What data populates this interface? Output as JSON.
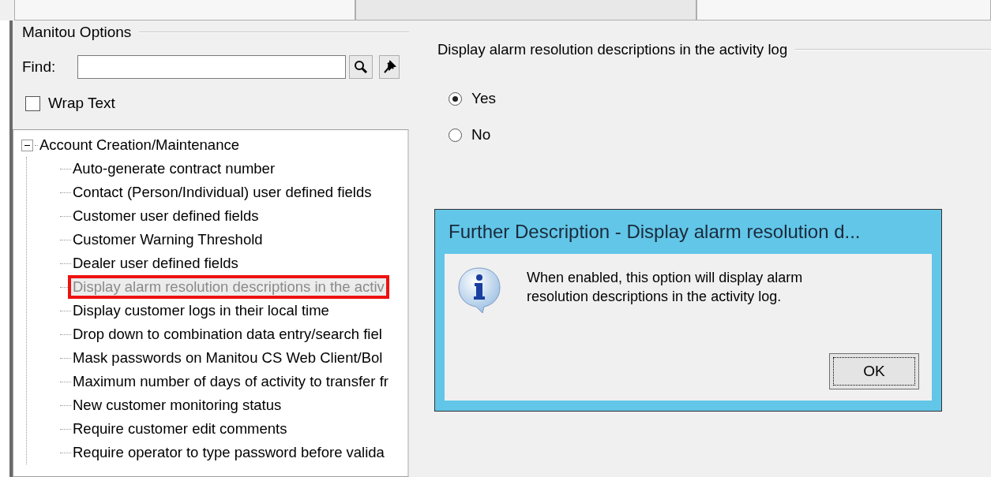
{
  "toolbar": {
    "buttons": [
      {
        "disabled": false
      },
      {
        "disabled": true
      },
      {
        "disabled": false
      }
    ]
  },
  "options_panel": {
    "title": "Manitou Options",
    "find": {
      "label": "Find:"
    },
    "wrap_text": {
      "label": "Wrap Text",
      "checked": false
    },
    "tree": [
      {
        "label": "Account Creation/Maintenance",
        "expanded": true,
        "selected": false,
        "children": [
          {
            "label": "Auto-generate contract number",
            "selected": false
          },
          {
            "label": "Contact (Person/Individual) user defined fields",
            "selected": false
          },
          {
            "label": "Customer user defined fields",
            "selected": false
          },
          {
            "label": "Customer Warning Threshold",
            "selected": false
          },
          {
            "label": "Dealer user defined fields",
            "selected": false
          },
          {
            "label": "Display alarm resolution descriptions in the activ",
            "selected": true
          },
          {
            "label": "Display customer logs in their local time",
            "selected": false
          },
          {
            "label": "Drop down to combination data entry/search fiel",
            "selected": false
          },
          {
            "label": "Mask passwords on Manitou CS Web Client/Bol",
            "selected": false
          },
          {
            "label": "Maximum number of days of activity to transfer fr",
            "selected": false
          },
          {
            "label": "New customer monitoring status",
            "selected": false
          },
          {
            "label": "Require customer edit comments",
            "selected": false
          },
          {
            "label": "Require operator to type password before valida",
            "selected": false
          }
        ]
      }
    ]
  },
  "setting": {
    "title": "Display alarm resolution descriptions in the activity log",
    "options": [
      {
        "label": "Yes",
        "selected": true
      },
      {
        "label": "No",
        "selected": false
      }
    ]
  },
  "dialog": {
    "title": "Further Description - Display alarm resolution d...",
    "message": "When enabled, this option will display alarm resolution descriptions in the activity log.",
    "buttons": [
      "OK"
    ]
  }
}
